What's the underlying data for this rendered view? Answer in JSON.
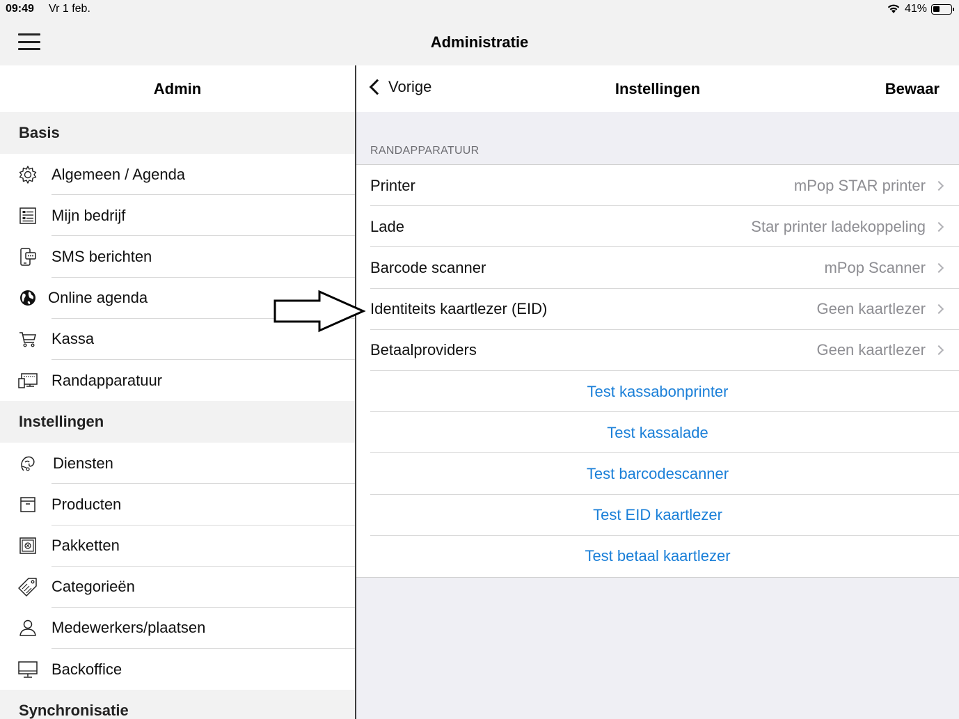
{
  "status": {
    "time": "09:49",
    "date": "Vr 1 feb.",
    "battery": "41%"
  },
  "topnav": {
    "title": "Administratie"
  },
  "left": {
    "title": "Admin",
    "sections": [
      {
        "header": "Basis",
        "items": [
          "Algemeen / Agenda",
          "Mijn bedrijf",
          "SMS berichten",
          "Online agenda",
          "Kassa",
          "Randapparatuur"
        ]
      },
      {
        "header": "Instellingen",
        "items": [
          "Diensten",
          "Producten",
          "Pakketten",
          "Categorieën",
          "Medewerkers/plaatsen",
          "Backoffice"
        ]
      },
      {
        "header": "Synchronisatie",
        "items": []
      }
    ]
  },
  "right": {
    "back_label": "Vorige",
    "title": "Instellingen",
    "save_label": "Bewaar",
    "group_title": "RANDAPPARATUUR",
    "rows": [
      {
        "label": "Printer",
        "value": "mPop STAR printer"
      },
      {
        "label": "Lade",
        "value": "Star printer ladekoppeling"
      },
      {
        "label": "Barcode scanner",
        "value": "mPop Scanner"
      },
      {
        "label": "Identiteits kaartlezer (EID)",
        "value": "Geen kaartlezer"
      },
      {
        "label": "Betaalproviders",
        "value": "Geen kaartlezer"
      }
    ],
    "actions": [
      "Test kassabonprinter",
      "Test kassalade",
      "Test barcodescanner",
      "Test EID kaartlezer",
      "Test betaal kaartlezer"
    ]
  },
  "colors": {
    "accent": "#1a7fd8",
    "secondary_text": "#8e8e93",
    "group_bg": "#efeff4"
  }
}
